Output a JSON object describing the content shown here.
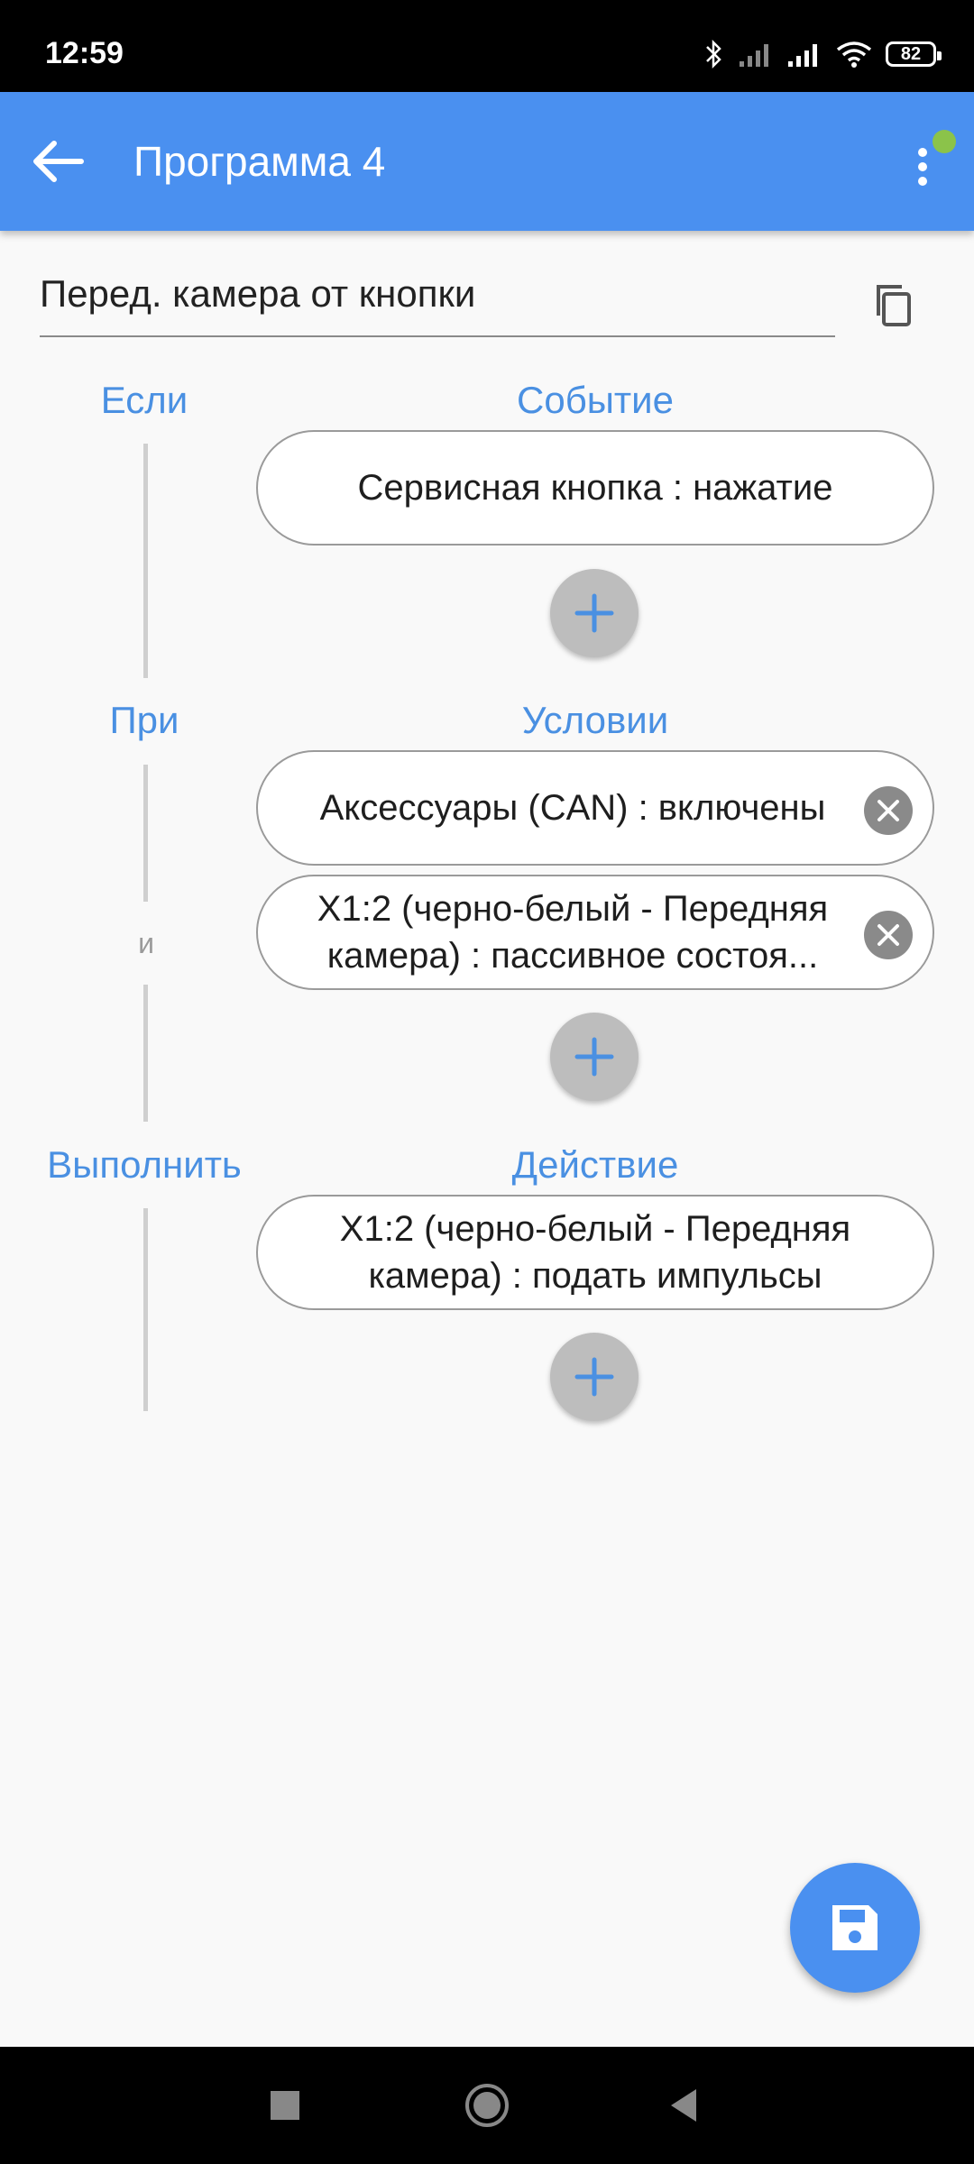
{
  "status_bar": {
    "time": "12:59",
    "battery": "82",
    "icons": [
      "bluetooth-icon",
      "signal-icon",
      "signal-icon",
      "wifi-icon",
      "battery-icon"
    ]
  },
  "app_bar": {
    "title": "Программа 4",
    "back_icon": "arrow-back-icon",
    "menu_icon": "more-vert-icon",
    "background_color": "#4a90f0"
  },
  "program": {
    "name": "Перед. камера от кнопки"
  },
  "sections": {
    "if": {
      "left": "Если",
      "right": "Событие"
    },
    "when": {
      "left": "При",
      "right": "Условии"
    },
    "do": {
      "left": "Выполнить",
      "right": "Действие"
    },
    "and_label": "и"
  },
  "event_items": [
    "Сервисная кнопка : нажатие"
  ],
  "condition_items": [
    "Аксессуары (CAN) : включены",
    "X1:2 (черно-белый - Передняя камера) : пассивное состоя..."
  ],
  "action_items": [
    "X1:2 (черно-белый - Передняя камера) : подать импульсы"
  ],
  "colors": {
    "accent": "#4a90e2",
    "status_dot": "#8bc34a"
  }
}
